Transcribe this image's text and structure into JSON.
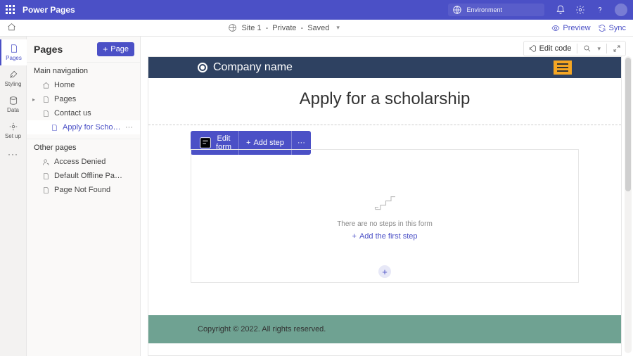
{
  "app": {
    "title": "Power Pages"
  },
  "env": {
    "label": "Environment"
  },
  "cmd": {
    "site": "Site 1",
    "privacy": "Private",
    "state": "Saved",
    "preview": "Preview",
    "sync": "Sync"
  },
  "rail": {
    "items": [
      {
        "label": "Pages"
      },
      {
        "label": "Styling"
      },
      {
        "label": "Data"
      },
      {
        "label": "Set up"
      }
    ]
  },
  "panel": {
    "title": "Pages",
    "new_button": "Page",
    "section_main": "Main navigation",
    "section_other": "Other pages",
    "main_items": [
      {
        "label": "Home"
      },
      {
        "label": "Pages"
      },
      {
        "label": "Contact us"
      },
      {
        "label": "Apply for Scholars..."
      }
    ],
    "other_items": [
      {
        "label": "Access Denied"
      },
      {
        "label": "Default Offline Page"
      },
      {
        "label": "Page Not Found"
      }
    ]
  },
  "tools": {
    "edit_code": "Edit code"
  },
  "site": {
    "company": "Company name",
    "page_title": "Apply for a scholarship",
    "footer": "Copyright © 2022. All rights reserved."
  },
  "form": {
    "edit": "Edit form",
    "add_step_btn": "Add step",
    "empty": "There are no steps in this form",
    "add_first": "Add the first step"
  }
}
